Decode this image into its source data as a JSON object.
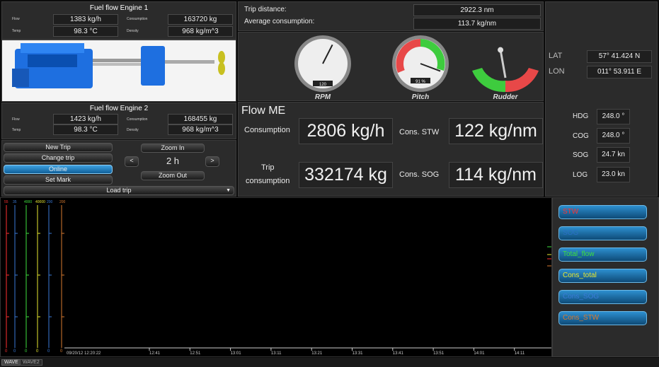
{
  "engine1": {
    "title": "Fuel flow Engine 1",
    "flow_label": "Flow",
    "flow_value": "1383 kg/h",
    "temp_label": "Temp",
    "temp_value": "98.3 °C",
    "consumption_label": "Consumption",
    "consumption_value": "163720 kg",
    "density_label": "Density",
    "density_value": "968 kg/m^3"
  },
  "engine2": {
    "title": "Fuel flow Engine 2",
    "flow_label": "Flow",
    "flow_value": "1423 kg/h",
    "temp_label": "Temp",
    "temp_value": "98.3 °C",
    "consumption_label": "Consumption",
    "consumption_value": "168455 kg",
    "density_label": "Density",
    "density_value": "968 kg/m^3"
  },
  "trip": {
    "distance_label": "Trip distance:",
    "distance_value": "2922.3 nm",
    "avg_label": "Average consumption:",
    "avg_value": "113.7 kg/nm"
  },
  "gauges": {
    "rpm_label": "RPM",
    "rpm_value": "120",
    "rpm_percent": 0.6,
    "pitch_label": "Pitch",
    "pitch_value": "91 %",
    "pitch_percent": 0.91,
    "rudder_label": "Rudder",
    "rudder_deg": -5
  },
  "position": {
    "lat_label": "LAT",
    "lat_value": "57° 41.424 N",
    "lon_label": "LON",
    "lon_value": "011° 53.911 E"
  },
  "navigation": {
    "hdg_label": "HDG",
    "hdg_value": "248.0 °",
    "cog_label": "COG",
    "cog_value": "248.0 °",
    "sog_label": "SOG",
    "sog_value": "24.7 kn",
    "log_label": "LOG",
    "log_value": "23.0 kn"
  },
  "flow_me": {
    "title": "Flow ME",
    "consumption_label": "Consumption",
    "consumption_value": "2806 kg/h",
    "stw_label": "Cons. STW",
    "stw_value": "122 kg/nm",
    "trip_label_1": "Trip",
    "trip_label_2": "consumption",
    "trip_value": "332174 kg",
    "sog_label": "Cons. SOG",
    "sog_value": "114 kg/nm"
  },
  "controls": {
    "new_trip": "New Trip",
    "change_trip": "Change trip",
    "online": "Online",
    "set_mark": "Set Mark",
    "load_trip": "Load trip",
    "zoom_in": "Zoom In",
    "zoom_out": "Zoom Out",
    "prev": "<",
    "next": ">",
    "span": "2 h"
  },
  "chart": {
    "start_label": "09/20/12 12:20:22",
    "axis_tops": [
      {
        "text": "55",
        "color": "#ff3030"
      },
      {
        "text": "35",
        "color": "#3a7ad8"
      },
      {
        "text": "4000",
        "color": "#3ee03e"
      },
      {
        "text": "40000",
        "color": "#e8e830"
      },
      {
        "text": "200",
        "color": "#3a7ad8"
      },
      {
        "text": "200",
        "color": "#d87a30"
      }
    ],
    "zero": "0",
    "ticks": [
      "12:41",
      "12:51",
      "13:01",
      "13:11",
      "13:21",
      "13:31",
      "13:41",
      "13:51",
      "14:01",
      "14:11"
    ]
  },
  "chart_data": {
    "type": "line",
    "x": [
      "09/20/12 12:20:22",
      "12:41",
      "12:51",
      "13:01",
      "13:11",
      "13:21",
      "13:31",
      "13:41",
      "13:51",
      "14:01",
      "14:11"
    ],
    "series": [
      {
        "name": "STW",
        "values": [],
        "color": "#ff3030"
      },
      {
        "name": "SOG",
        "values": [],
        "color": "#3a7ad8"
      },
      {
        "name": "Total_flow",
        "values": [],
        "color": "#3ee03e"
      },
      {
        "name": "Cons_total",
        "values": [],
        "color": "#e8e830"
      },
      {
        "name": "Cons_SOG",
        "values": [],
        "color": "#3a7ad8"
      },
      {
        "name": "Cons_STW",
        "values": [],
        "color": "#d87a30"
      }
    ]
  },
  "traces": [
    {
      "label": "STW",
      "color": "#ff3030"
    },
    {
      "label": "SOG",
      "color": "#2a6fc4"
    },
    {
      "label": "Total_flow",
      "color": "#3ee03e"
    },
    {
      "label": "Cons_total",
      "color": "#e8e830"
    },
    {
      "label": "Cons_SOG",
      "color": "#3a7ad8"
    },
    {
      "label": "Cons_STW",
      "color": "#d87a30"
    }
  ],
  "tabs": [
    "WAVE",
    "WAVE2"
  ]
}
